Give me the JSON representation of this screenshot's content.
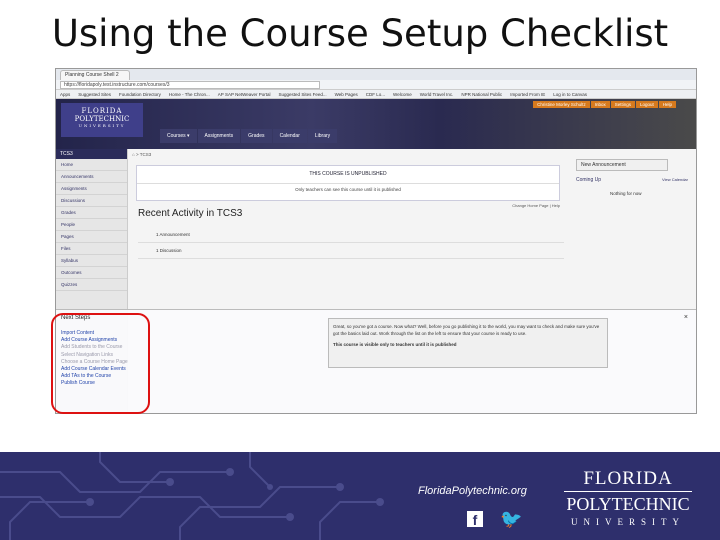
{
  "slide_title": "Using the Course Setup Checklist",
  "browser": {
    "tab_label": "Planning Course Shell 2",
    "url": "https://floridapoly.test.instructure.com/courses/3",
    "bookmarks": [
      "Apps",
      "Suggested Sites",
      "Foundation Directory",
      "Home - The Chron...",
      "AP SAP NetWeaver Portal",
      "Suggested Sites Feed...",
      "Web Pages",
      "CDF Lo...",
      "Welcome",
      "World Travel Inc.",
      "NPR National Public",
      "Imported From IE",
      "Log in to Canvas"
    ]
  },
  "canvas": {
    "logo": {
      "line1": "FLORIDA",
      "line2": "POLYTECHNIC",
      "line3": "UNIVERSITY"
    },
    "user_bar": [
      "Christine Morley Schultz",
      "Inbox",
      "Settings",
      "Logout",
      "Help"
    ],
    "nav": [
      "Courses ▾",
      "Assignments",
      "Grades",
      "Calendar",
      "Library"
    ],
    "course_code": "TCS3",
    "breadcrumb": "⌂ > TCS3",
    "sidebar": [
      "Home",
      "Announcements",
      "Assignments",
      "Discussions",
      "Grades",
      "People",
      "Pages",
      "Files",
      "Syllabus",
      "Outcomes",
      "Quizzes"
    ],
    "banner_title": "THIS COURSE IS UNPUBLISHED",
    "banner_text": "Only teachers can see this course until it is published",
    "change_home": "Change Home Page | Help",
    "recent_heading": "Recent Activity in TCS3",
    "feed": [
      "1 Announcement",
      "1 Discussion"
    ],
    "new_announcement": "New Announcement",
    "coming_up": "Coming Up",
    "view_calendar": "View Calendar",
    "nothing": "Nothing for now"
  },
  "next_steps": {
    "title": "Next Steps",
    "items": [
      "Import Content",
      "Add Course Assignments",
      "Add Students to the Course",
      "Select Navigation Links",
      "Choose a Course Home Page",
      "Add Course Calendar Events",
      "Add TAs to the Course",
      "Publish Course"
    ],
    "message": "Great, so you've got a course. Now what? Well, before you go publishing it to the world, you may want to check and make sure you've got the basics laid out. Work through the list on the left to ensure that your course is ready to use.",
    "message2": "This course is visible only to teachers until it is published",
    "close": "×"
  },
  "footer": {
    "url": "FloridaPolytechnic.org",
    "logo1": "FLORIDA",
    "logo2": "POLYTECHNIC",
    "logo3": "UNIVERSITY",
    "facebook": "f",
    "twitter": "🐦"
  }
}
